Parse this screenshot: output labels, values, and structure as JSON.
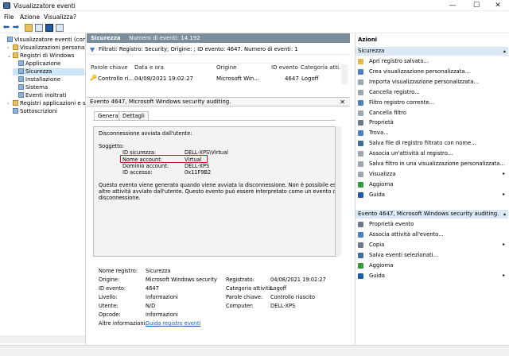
{
  "window": {
    "title": "Visualizzatore eventi",
    "minimize": "—",
    "maximize": "☐",
    "close": "✕"
  },
  "menu": [
    "File",
    "Azione",
    "Visualizza",
    "?"
  ],
  "tree": {
    "items": [
      {
        "label": "Visualizzatore eventi (computer",
        "level": 0,
        "selected": false,
        "kind": "root",
        "arrow": ""
      },
      {
        "label": "Visualizzazioni personalizzate",
        "level": 1,
        "selected": false,
        "kind": "folder",
        "arrow": "›"
      },
      {
        "label": "Registri di Windows",
        "level": 1,
        "selected": false,
        "kind": "folder",
        "arrow": "⌄"
      },
      {
        "label": "Applicazione",
        "level": 2,
        "selected": false,
        "kind": "log",
        "arrow": ""
      },
      {
        "label": "Sicurezza",
        "level": 2,
        "selected": true,
        "kind": "log",
        "arrow": ""
      },
      {
        "label": "Installazione",
        "level": 2,
        "selected": false,
        "kind": "log",
        "arrow": ""
      },
      {
        "label": "Sistema",
        "level": 2,
        "selected": false,
        "kind": "log",
        "arrow": ""
      },
      {
        "label": "Eventi inoltrati",
        "level": 2,
        "selected": false,
        "kind": "log",
        "arrow": ""
      },
      {
        "label": "Registri applicazioni e servizi",
        "level": 1,
        "selected": false,
        "kind": "folder",
        "arrow": "›"
      },
      {
        "label": "Sottoscrizioni",
        "level": 1,
        "selected": false,
        "kind": "log",
        "arrow": ""
      }
    ]
  },
  "center": {
    "log_name": "Sicurezza",
    "event_count_label": "Numero di eventi: 14.192",
    "filter_text": "Filtrati: Registro: Security; Origine: ; ID evento: 4647. Numero di eventi: 1",
    "columns": [
      "Parole chiave",
      "Data e ora",
      "Origine",
      "ID evento",
      "Categoria atti..."
    ],
    "rows": [
      {
        "keywords": "Controllo ri...",
        "datetime": "04/08/2021 19:02:27",
        "source": "Microsoft Win...",
        "id": "4647",
        "category": "Logoff"
      }
    ]
  },
  "detail": {
    "title": "Evento 4647, Microsoft Windows security auditing.",
    "tabs": [
      "Generale",
      "Dettagli"
    ],
    "message": {
      "line1": "Disconnessione avviata dall'utente:",
      "subject": "Soggetto:",
      "fields": [
        {
          "label": "ID sicurezza:",
          "value": "DELL-XPS\\Virtual"
        },
        {
          "label": "Nome account:",
          "value": "Virtual"
        },
        {
          "label": "Dominio account:",
          "value": "DELL-XPS"
        },
        {
          "label": "ID accesso:",
          "value": "0x11F9B2"
        }
      ],
      "para1": "Questo evento viene generato quando viene avviata la disconnessione. Non è possibile eseguire",
      "para2": "altre attività avviate dall'utente. Questo evento può essere interpretato come un evento di",
      "para3": "disconnessione."
    },
    "props": {
      "nome_registro_label": "Nome registro:",
      "nome_registro": "Sicurezza",
      "origine_label": "Origine:",
      "origine": "Microsoft Windows security",
      "registrato_label": "Registrato:",
      "registrato": "04/08/2021 19:02:27",
      "id_evento_label": "ID evento:",
      "id_evento": "4647",
      "categoria_label": "Categoria attività:",
      "categoria": "Logoff",
      "livello_label": "Livello:",
      "livello": "Informazioni",
      "parole_label": "Parole chiave:",
      "parole": "Controllo riuscito",
      "utente_label": "Utente:",
      "utente": "N/D",
      "computer_label": "Computer:",
      "computer": "DELL-XPS",
      "opcode_label": "Opcode:",
      "opcode": "Informazioni",
      "altre_label": "Altre informazioni:",
      "altre_link": "Guida registro eventi"
    }
  },
  "actions": {
    "header": "Azioni",
    "section1": "Sicurezza",
    "items1": [
      {
        "label": "Apri registro salvato...",
        "icon": "folder-open-icon",
        "color": "#e8b84a",
        "sub": ""
      },
      {
        "label": "Crea visualizzazione personalizzata...",
        "icon": "filter-icon",
        "color": "#4a7fc0",
        "sub": ""
      },
      {
        "label": "Importa visualizzazione personalizzata...",
        "icon": "import-icon",
        "color": "",
        "sub": ""
      },
      {
        "label": "Cancella registro...",
        "icon": "clear-log-icon",
        "color": "",
        "sub": ""
      },
      {
        "label": "Filtro registro corrente...",
        "icon": "filter-icon",
        "color": "#4a7fc0",
        "sub": ""
      },
      {
        "label": "Cancella filtro",
        "icon": "clear-filter-icon",
        "color": "",
        "sub": ""
      },
      {
        "label": "Proprietà",
        "icon": "properties-icon",
        "color": "#6a7a8a",
        "sub": ""
      },
      {
        "label": "Trova...",
        "icon": "find-icon",
        "color": "#4a7fc0",
        "sub": ""
      },
      {
        "label": "Salva file di registro filtrato con nome...",
        "icon": "save-icon",
        "color": "#3d6d9e",
        "sub": ""
      },
      {
        "label": "Associa un'attività al registro...",
        "icon": "task-icon",
        "color": "",
        "sub": ""
      },
      {
        "label": "Salva filtro in una visualizzazione personalizzata...",
        "icon": "save-filter-icon",
        "color": "",
        "sub": ""
      },
      {
        "label": "Visualizza",
        "icon": "view-icon",
        "color": "",
        "sub": "▸"
      },
      {
        "label": "Aggiorna",
        "icon": "refresh-icon",
        "color": "#2e9a3a",
        "sub": ""
      },
      {
        "label": "Guida",
        "icon": "help-icon",
        "color": "#1f5aa8",
        "sub": "▸"
      }
    ],
    "section2": "Evento 4647, Microsoft Windows security auditing.",
    "items2": [
      {
        "label": "Proprietà evento",
        "icon": "event-properties-icon",
        "color": "#6a7a8a",
        "sub": ""
      },
      {
        "label": "Associa attività all'evento...",
        "icon": "task-icon",
        "color": "#4a7fc0",
        "sub": ""
      },
      {
        "label": "Copia",
        "icon": "copy-icon",
        "color": "#6a7a8a",
        "sub": "▸"
      },
      {
        "label": "Salva eventi selezionati...",
        "icon": "save-icon",
        "color": "#3d6d9e",
        "sub": ""
      },
      {
        "label": "Aggiorna",
        "icon": "refresh-icon",
        "color": "#2e9a3a",
        "sub": ""
      },
      {
        "label": "Guida",
        "icon": "help-icon",
        "color": "#1f5aa8",
        "sub": "▸"
      }
    ]
  }
}
